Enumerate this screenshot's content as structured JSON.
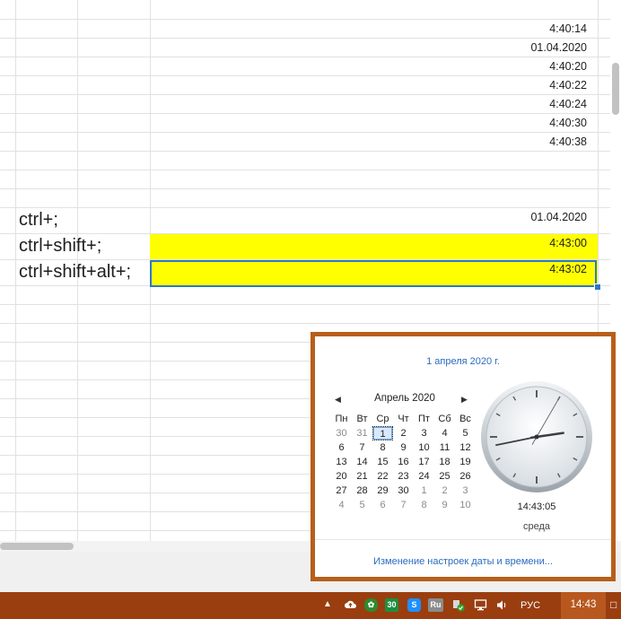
{
  "sheet": {
    "rows": [
      {
        "value": "4:40:14"
      },
      {
        "value": "01.04.2020"
      },
      {
        "value": "4:40:20"
      },
      {
        "value": "4:40:22"
      },
      {
        "value": "4:40:24"
      },
      {
        "value": "4:40:30"
      },
      {
        "value": "4:40:38"
      }
    ],
    "shortcuts": [
      {
        "label": "ctrl+;",
        "value": "01.04.2020"
      },
      {
        "label": "ctrl+shift+;",
        "value": "4:43:00"
      },
      {
        "label": "ctrl+shift+alt+;",
        "value": "4:43:02"
      }
    ],
    "highlight_color": "#ffff00",
    "selection_color": "#2f78c6"
  },
  "calendar_popup": {
    "full_date": "1 апреля 2020 г.",
    "month_title": "Апрель 2020",
    "weekdays": [
      "Пн",
      "Вт",
      "Ср",
      "Чт",
      "Пт",
      "Сб",
      "Вс"
    ],
    "weeks": [
      [
        "30",
        "31",
        "1",
        "2",
        "3",
        "4",
        "5"
      ],
      [
        "6",
        "7",
        "8",
        "9",
        "10",
        "11",
        "12"
      ],
      [
        "13",
        "14",
        "15",
        "16",
        "17",
        "18",
        "19"
      ],
      [
        "20",
        "21",
        "22",
        "23",
        "24",
        "25",
        "26"
      ],
      [
        "27",
        "28",
        "29",
        "30",
        "1",
        "2",
        "3"
      ],
      [
        "4",
        "5",
        "6",
        "7",
        "8",
        "9",
        "10"
      ]
    ],
    "today": "1",
    "clock_time": "14:43:05",
    "clock_hours": 14,
    "clock_minutes": 43,
    "clock_seconds": 5,
    "weekday_name": "среда",
    "settings_link": "Изменение настроек даты и времени...",
    "border_color": "#b85f1a"
  },
  "taskbar": {
    "tray_icons": [
      "chevron-up-icon",
      "cloud-upload-icon",
      "green-leaf-icon",
      "counter-30-icon",
      "skype-icon",
      "ru-keyboard-icon",
      "security-check-icon",
      "network-icon",
      "volume-icon"
    ],
    "counter_label": "30",
    "skype_label": "S",
    "ru_label": "Ru",
    "language": "РУС",
    "time": "14:43",
    "color": "#9a3e10"
  }
}
